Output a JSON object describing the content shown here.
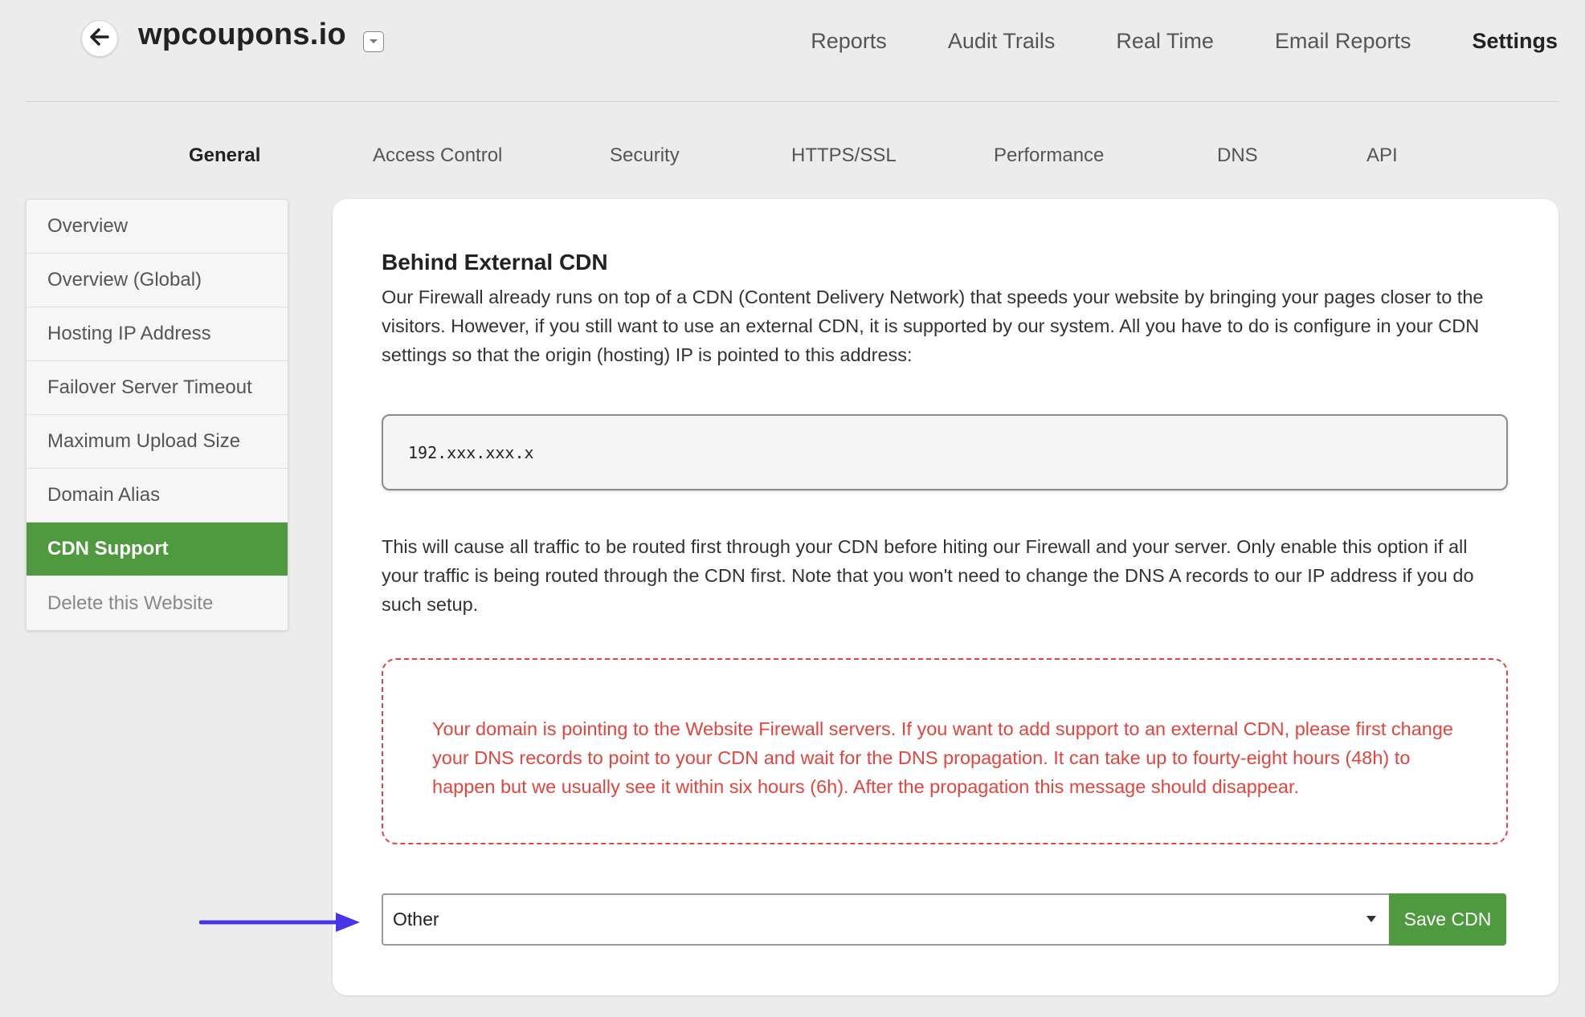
{
  "header": {
    "site_name": "wpcoupons.io",
    "back_icon": "arrow-left-icon",
    "dropdown_icon": "chevron-down-icon",
    "nav": [
      {
        "label": "Reports",
        "active": false
      },
      {
        "label": "Audit Trails",
        "active": false
      },
      {
        "label": "Real Time",
        "active": false
      },
      {
        "label": "Email Reports",
        "active": false
      },
      {
        "label": "Settings",
        "active": true
      }
    ]
  },
  "tabs": [
    {
      "label": "General",
      "active": true
    },
    {
      "label": "Access Control",
      "active": false
    },
    {
      "label": "Security",
      "active": false
    },
    {
      "label": "HTTPS/SSL",
      "active": false
    },
    {
      "label": "Performance",
      "active": false
    },
    {
      "label": "DNS",
      "active": false
    },
    {
      "label": "API",
      "active": false
    }
  ],
  "sidebar": {
    "items": [
      {
        "label": "Overview",
        "active": false
      },
      {
        "label": "Overview (Global)",
        "active": false
      },
      {
        "label": "Hosting IP Address",
        "active": false
      },
      {
        "label": "Failover Server Timeout",
        "active": false
      },
      {
        "label": "Maximum Upload Size",
        "active": false
      },
      {
        "label": "Domain Alias",
        "active": false
      },
      {
        "label": "CDN Support",
        "active": true
      },
      {
        "label": "Delete this Website",
        "active": false
      }
    ]
  },
  "panel": {
    "title": "Behind External CDN",
    "intro": "Our Firewall already runs on top of a CDN (Content Delivery Network) that speeds your website by bringing your pages closer to the visitors. However, if you still want to use an external CDN, it is supported by our system. All you have to do is configure in your CDN settings so that the origin (hosting) IP is pointed to this address:",
    "ip_address": "192.xxx.xxx.x",
    "routing_note": "This will cause all traffic to be routed first through your CDN before hiting our Firewall and your server. Only enable this option if all your traffic is being routed through the CDN first. Note that you won't need to change the DNS A records to our IP address if you do such setup.",
    "alert": "Your domain is pointing to the Website Firewall servers. If you want to add support to an external CDN, please first change your DNS records to point to your CDN and wait for the DNS propagation. It can take up to fourty-eight hours (48h) to happen but we usually see it within six hours (6h). After the propagation this message should disappear.",
    "cdn_select_value": "Other",
    "save_button": "Save CDN"
  },
  "colors": {
    "accent_green": "#4f9a3f",
    "alert_red": "#e0463f",
    "annotation_arrow": "#4636e8"
  }
}
